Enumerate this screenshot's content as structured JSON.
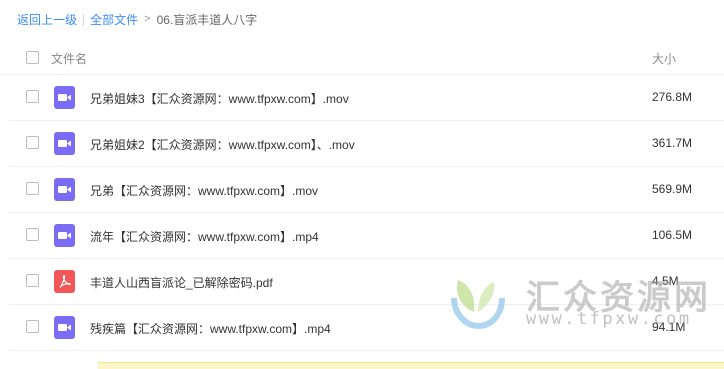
{
  "breadcrumb": {
    "back": "返回上一级",
    "all_files": "全部文件",
    "separator": ">",
    "current": "06.盲派丰道人八字"
  },
  "table": {
    "col_name": "文件名",
    "col_size": "大小"
  },
  "files": [
    {
      "name": "兄弟姐妹3【汇众资源网：www.tfpxw.com】.mov",
      "size": "276.8M",
      "icon": "video-file-icon"
    },
    {
      "name": "兄弟姐妹2【汇众资源网：www.tfpxw.com】、.mov",
      "size": "361.7M",
      "icon": "video-file-icon"
    },
    {
      "name": "兄弟【汇众资源网：www.tfpxw.com】.mov",
      "size": "569.9M",
      "icon": "video-file-icon"
    },
    {
      "name": "流年【汇众资源网：www.tfpxw.com】.mp4",
      "size": "106.5M",
      "icon": "video-file-icon"
    },
    {
      "name": "丰道人山西盲派论_已解除密码.pdf",
      "size": "4.5M",
      "icon": "pdf-file-icon"
    },
    {
      "name": "残疾篇【汇众资源网：www.tfpxw.com】.mp4",
      "size": "94.1M",
      "icon": "video-file-icon"
    }
  ],
  "watermark": {
    "title": "汇众资源网",
    "url": "www.tfpxw.com"
  },
  "colors": {
    "link": "#3b8cff",
    "video_icon": "#7b6cf6",
    "pdf_icon": "#f25757"
  }
}
